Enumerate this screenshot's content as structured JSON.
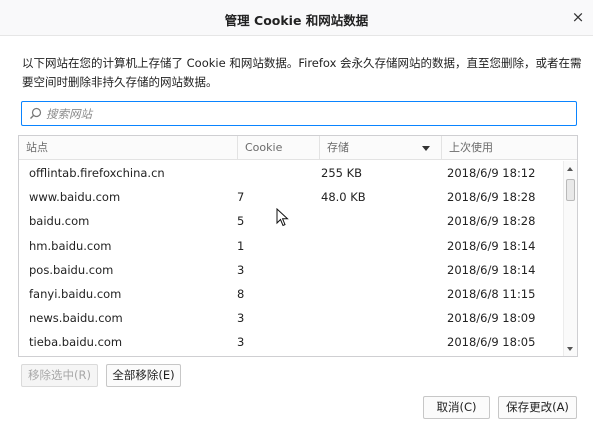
{
  "dialog": {
    "title": "管理 Cookie 和网站数据",
    "close_glyph": "×",
    "description": "以下网站在您的计算机上存储了 Cookie 和网站数据。Firefox 会永久存储网站的数据，直至您删除，或者在需要空间时删除非持久存储的网站数据。"
  },
  "search": {
    "placeholder": "搜索网站",
    "value": ""
  },
  "table": {
    "columns": {
      "site": "站点",
      "cookie": "Cookie",
      "storage": "存储",
      "last_used": "上次使用"
    },
    "sorted_by": "storage",
    "sort_direction": "descending",
    "rows": [
      {
        "site": "offlintab.firefoxchina.cn",
        "cookie": "",
        "storage": "255 KB",
        "last_used": "2018/6/9 18:12"
      },
      {
        "site": "www.baidu.com",
        "cookie": "7",
        "storage": "48.0 KB",
        "last_used": "2018/6/9 18:28"
      },
      {
        "site": "baidu.com",
        "cookie": "5",
        "storage": "",
        "last_used": "2018/6/9 18:28"
      },
      {
        "site": "hm.baidu.com",
        "cookie": "1",
        "storage": "",
        "last_used": "2018/6/9 18:14"
      },
      {
        "site": "pos.baidu.com",
        "cookie": "3",
        "storage": "",
        "last_used": "2018/6/9 18:14"
      },
      {
        "site": "fanyi.baidu.com",
        "cookie": "8",
        "storage": "",
        "last_used": "2018/6/8 11:15"
      },
      {
        "site": "news.baidu.com",
        "cookie": "3",
        "storage": "",
        "last_used": "2018/6/9 18:09"
      },
      {
        "site": "tieba.baidu.com",
        "cookie": "3",
        "storage": "",
        "last_used": "2018/6/9 18:05"
      }
    ]
  },
  "buttons": {
    "remove_selected": "移除选中(R)",
    "remove_all": "全部移除(E)",
    "cancel": "取消(C)",
    "save": "保存更改(A)"
  },
  "colors": {
    "focus_accent": "#0a84ff",
    "disabled_text": "#a8a8a8"
  }
}
